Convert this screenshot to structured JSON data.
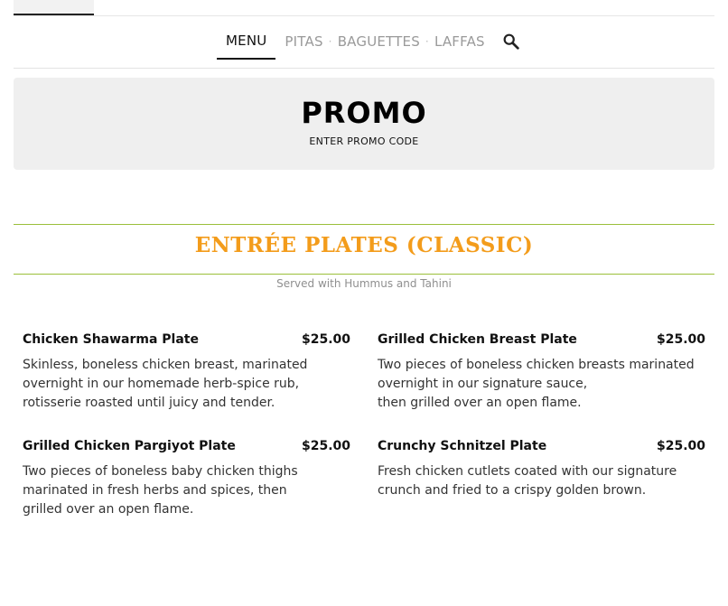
{
  "nav": {
    "active": "MENU",
    "links": [
      "PITAS",
      "BAGUETTES",
      "LAFFAS"
    ],
    "separator": "·"
  },
  "promo": {
    "title": "PROMO",
    "subtitle": "ENTER PROMO CODE"
  },
  "section": {
    "title": "ENTRÉE PLATES (CLASSIC)",
    "subtitle": "Served with Hummus and Tahini",
    "accent_color": "#f39c1b",
    "rule_color": "#9bbf3a"
  },
  "items": [
    {
      "name": "Chicken Shawarma Plate",
      "price": "$25.00",
      "description": "Skinless, boneless chicken breast, marinated overnight in our homemade herb-spice rub,\nrotisserie roasted until juicy and tender."
    },
    {
      "name": "Grilled Chicken Breast Plate",
      "price": "$25.00",
      "description": "Two pieces of boneless chicken breasts marinated overnight in our signature sauce,\nthen grilled over an open flame."
    },
    {
      "name": "Grilled Chicken Pargiyot Plate",
      "price": "$25.00",
      "description": "Two pieces of boneless baby chicken thighs marinated in fresh herbs and spices, then\ngrilled over an open flame."
    },
    {
      "name": "Crunchy Schnitzel Plate",
      "price": "$25.00",
      "description": "Fresh chicken cutlets coated with our signature crunch and fried to a crispy golden brown."
    }
  ],
  "icons": {
    "search": "search-icon"
  }
}
